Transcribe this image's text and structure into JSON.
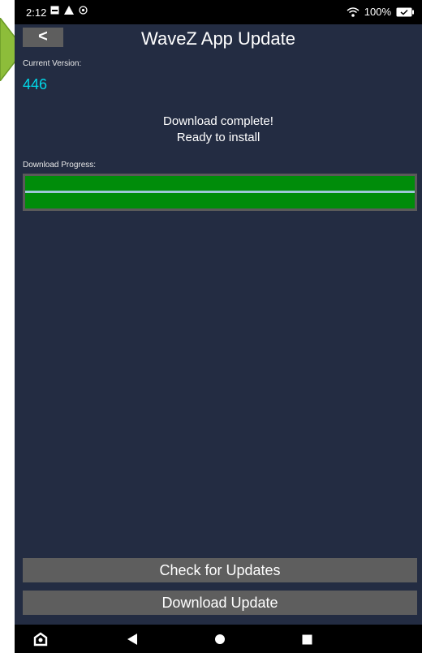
{
  "status_bar": {
    "time": "2:12",
    "battery": "100%"
  },
  "header": {
    "back_label": "<",
    "title": "WaveZ App Update"
  },
  "version": {
    "label": "Current Version:",
    "value": "446"
  },
  "status": {
    "line1": "Download complete!",
    "line2": "Ready to install"
  },
  "progress": {
    "label": "Download Progress:",
    "value": 1.0,
    "fill_color": "#008c0a"
  },
  "buttons": {
    "check": "Check for Updates",
    "download": "Download Update"
  },
  "colors": {
    "background": "#232c42",
    "accent_version": "#00d8e8",
    "button": "#5e5e5e"
  },
  "icons": [
    "notification-icon",
    "alert-icon",
    "settings-icon",
    "wifi-icon",
    "battery-icon",
    "home-assistant-icon",
    "back-nav-icon",
    "home-nav-icon",
    "recents-nav-icon"
  ]
}
